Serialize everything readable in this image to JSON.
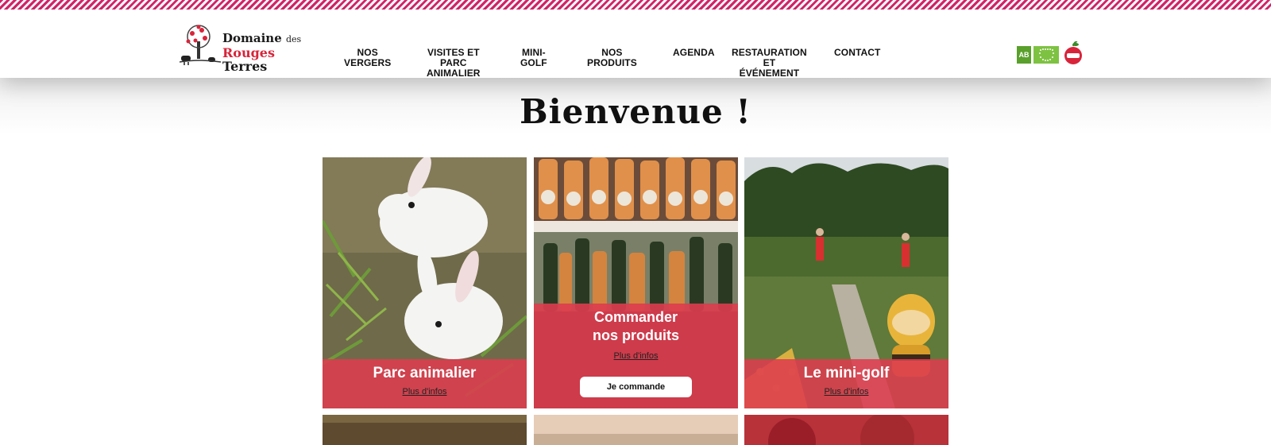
{
  "brand": {
    "line1": "Domaine",
    "line1_small": "des",
    "line2_red": "Rouges",
    "line2_dark": "Terres"
  },
  "nav": [
    {
      "label": "NOS VERGERS"
    },
    {
      "label": "VISITES ET PARC",
      "label2": "ANIMALIER"
    },
    {
      "label": "MINI-GOLF"
    },
    {
      "label": "NOS PRODUITS"
    },
    {
      "label": "AGENDA"
    },
    {
      "label": "RESTAURATION ET",
      "label2": "ÉVÉNEMENT"
    },
    {
      "label": "CONTACT"
    }
  ],
  "badges": {
    "ab": "AB",
    "icons": [
      "ab-organic-icon",
      "eu-organic-leaf-icon",
      "apple-logo-icon"
    ]
  },
  "page": {
    "title": "Bienvenue !"
  },
  "cards": [
    {
      "title": "Parc animalier",
      "link": "Plus d'infos",
      "image": "white-rabbits-photo"
    },
    {
      "title_line1": "Commander",
      "title_line2": "nos produits",
      "link": "Plus d'infos",
      "button": "Je commande",
      "image": "cider-bottles-photo"
    },
    {
      "title": "Le mini-golf",
      "link": "Plus d'infos",
      "image": "mini-golf-photo"
    }
  ],
  "colors": {
    "accent_red": "#dd3c4e",
    "stripe_pink": "#d8246a",
    "organic_green": "#5aa02c"
  }
}
